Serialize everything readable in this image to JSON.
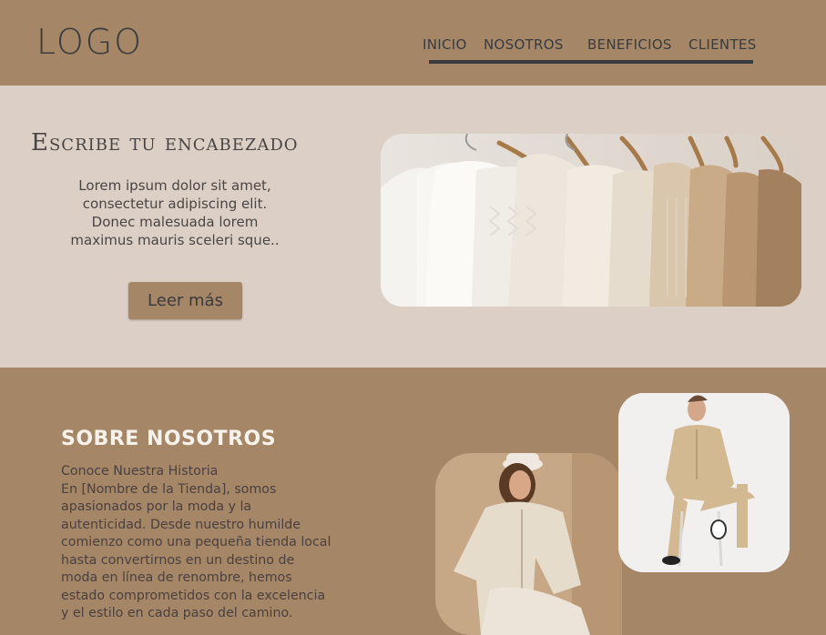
{
  "header": {
    "logo": "LOGO",
    "nav": [
      "INICIO",
      "NOSOTROS",
      "BENEFICIOS",
      "CLIENTES"
    ]
  },
  "hero": {
    "title": "Escribe tu encabezado",
    "text_lines": [
      "Lorem ipsum dolor sit amet,",
      "consectetur adipiscing elit.",
      "Donec malesuada lorem",
      "maximus mauris sceleri sque.."
    ],
    "button": "Leer más"
  },
  "about": {
    "title": "SOBRE NOSOTROS",
    "text": "Conoce Nuestra Historia\nEn [Nombre de la Tienda], somos\napasionados por la moda y la\nautenticidad. Desde nuestro humilde\ncomienzo como una pequeña tienda local\nhasta convertirnos en un destino de\nmoda en línea de renombre, hemos\nestado comprometidos con la excelencia\ny el estilo en cada paso del camino."
  },
  "colors": {
    "brand": "#a58666",
    "hero_bg": "#dcd0c6",
    "text_dark": "#3a3b3f"
  }
}
